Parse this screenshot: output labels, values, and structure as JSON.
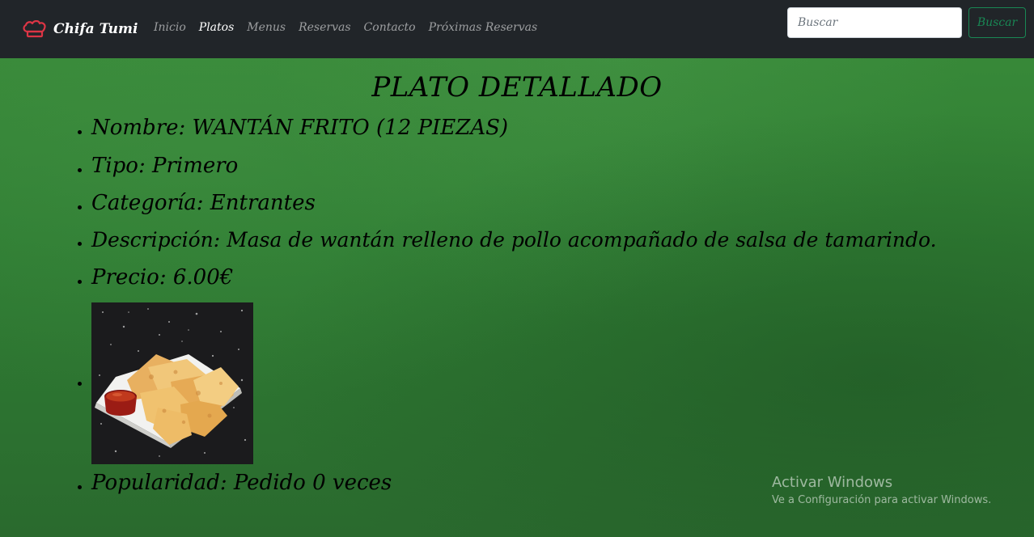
{
  "navbar": {
    "brand": "Chifa Tumi",
    "brand_icon": "chef-hat-icon",
    "brand_icon_color": "#dc3545",
    "links": [
      {
        "label": "Inicio",
        "active": false
      },
      {
        "label": "Platos",
        "active": true
      },
      {
        "label": "Menus",
        "active": false
      },
      {
        "label": "Reservas",
        "active": false
      },
      {
        "label": "Contacto",
        "active": false
      },
      {
        "label": "Próximas Reservas",
        "active": false
      }
    ],
    "search": {
      "placeholder": "Buscar",
      "value": "",
      "button_label": "Buscar"
    }
  },
  "page": {
    "title": "PLATO DETALLADO",
    "background_color": "#2f7d33"
  },
  "dish": {
    "nombre": "Nombre: WANTÁN FRITO (12 PIEZAS)",
    "tipo": "Tipo: Primero",
    "categoria": "Categoría: Entrantes",
    "descripcion": "Descripción: Masa de wantán relleno de pollo acompañado de salsa de tamarindo.",
    "precio": "Precio: 6.00€",
    "popularidad": "Popularidad: Pedido 0 veces",
    "image": "fried-wonton-plate-photo"
  },
  "watermark": {
    "title": "Activar Windows",
    "subtitle": "Ve a Configuración para activar Windows."
  }
}
